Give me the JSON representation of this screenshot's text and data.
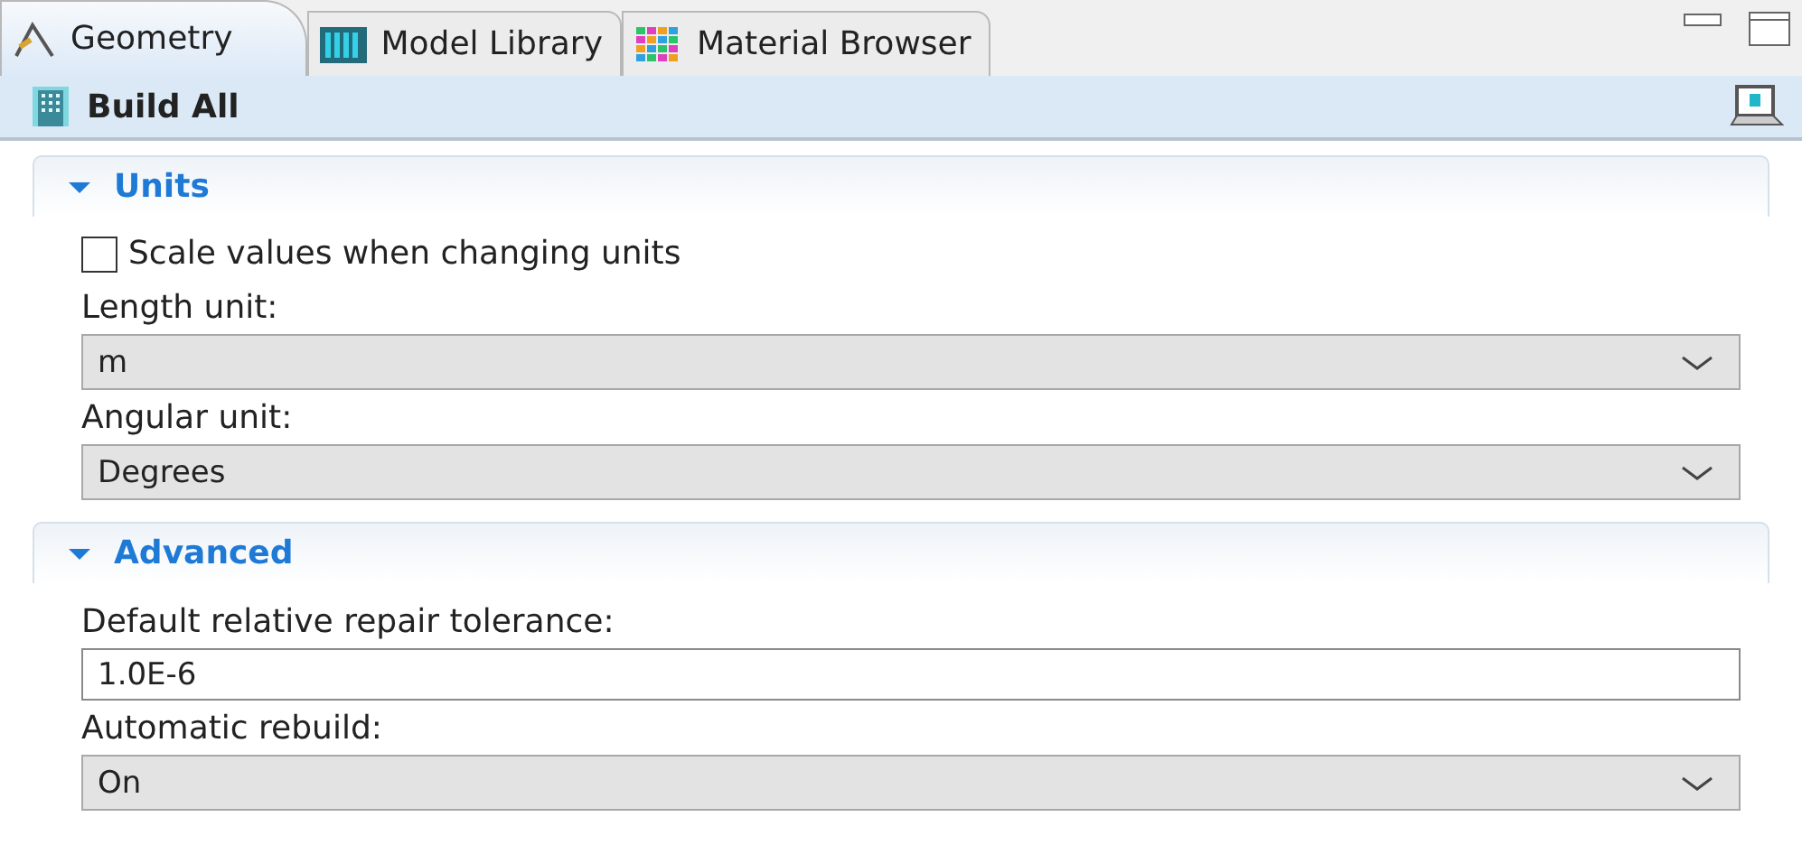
{
  "tabs": [
    {
      "label": "Geometry",
      "selected": true
    },
    {
      "label": "Model Library",
      "selected": false
    },
    {
      "label": "Material Browser",
      "selected": false
    }
  ],
  "toolbar": {
    "build_button": "Build All"
  },
  "sections": [
    {
      "title": "Units",
      "expanded": true,
      "items": [
        {
          "kind": "checkbox",
          "label": "Scale values when changing units",
          "checked": false
        },
        {
          "kind": "select",
          "label": "Length unit:",
          "value": "m"
        },
        {
          "kind": "select",
          "label": "Angular unit:",
          "value": "Degrees"
        }
      ]
    },
    {
      "title": "Advanced",
      "expanded": true,
      "items": [
        {
          "kind": "text",
          "label": "Default relative repair tolerance:",
          "value": "1.0E-6"
        },
        {
          "kind": "select",
          "label": "Automatic rebuild:",
          "value": "On"
        }
      ]
    }
  ]
}
